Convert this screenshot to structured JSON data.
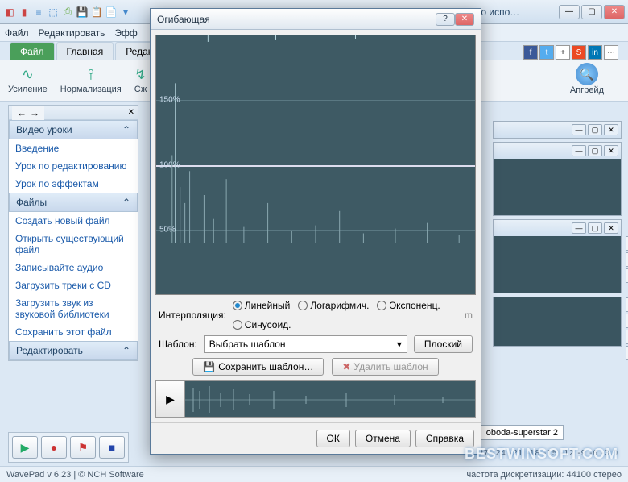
{
  "app": {
    "title": "WavePad NCH Software - (Без лицензии) Только для некоммерческого испо…",
    "menu": [
      "Файл",
      "Редактировать",
      "Эфф"
    ],
    "status_version": "WavePad v 6.23  |  © NCH Software",
    "status_info": "частота дискретизации: 44100     стерео"
  },
  "ribbon": {
    "tabs": [
      {
        "label": "Файл",
        "active": true
      },
      {
        "label": "Главная",
        "active": false
      },
      {
        "label": "Редактир",
        "active": false
      }
    ],
    "groups": [
      {
        "icon": "∿",
        "label": "Усиление"
      },
      {
        "icon": "⫯",
        "label": "Нормализация"
      },
      {
        "icon": "↯",
        "label": "Сж"
      }
    ],
    "upgrade": "Апгрейд"
  },
  "social": [
    "f",
    "t",
    "+",
    "S",
    "in",
    "⋯"
  ],
  "sidebar": {
    "nav_icons": [
      "←",
      "→"
    ],
    "close": "✕",
    "sections": [
      {
        "title": "Видео уроки",
        "links": [
          "Введение",
          "Урок по редактированию",
          "Урок по эффектам"
        ]
      },
      {
        "title": "Файлы",
        "links": [
          "Создать новый файл",
          "Открыть существующий файл",
          "Записывайте аудио",
          "Загрузить треки с CD",
          "Загрузить звук из звуковой библиотеки",
          "Сохранить этот файл"
        ]
      },
      {
        "title": "Редактировать",
        "links": []
      }
    ]
  },
  "file_badge": "loboda-superstar 2",
  "ruler": "-27 -24 -21 -18 -15 -12 -9 -6 -3 0",
  "modal": {
    "title": "Огибающая",
    "grid_labels": [
      "150%",
      "100%",
      "50%"
    ],
    "interp_label": "Интерполяция:",
    "interp_opts": [
      {
        "label": "Линейный",
        "sel": true
      },
      {
        "label": "Логарифмич.",
        "sel": false
      },
      {
        "label": "Экспоненц.",
        "sel": false
      },
      {
        "label": "Синусоид.",
        "sel": false
      }
    ],
    "template_label": "Шаблон:",
    "template_combo": "Выбрать шаблон",
    "btn_flat": "Плоский",
    "btn_save_tpl": "Сохранить шаблон…",
    "btn_del_tpl": "Удалить шаблон",
    "ok": "ОК",
    "cancel": "Отмена",
    "help": "Справка",
    "scale_m": "m"
  },
  "watermark": "BESTWINSOFT.COM"
}
